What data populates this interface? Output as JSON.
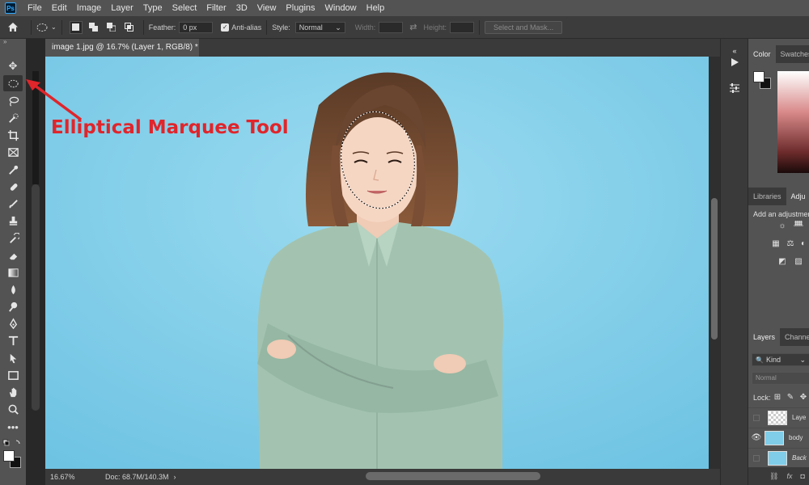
{
  "app": {
    "logo": "Ps"
  },
  "menu": [
    "File",
    "Edit",
    "Image",
    "Layer",
    "Type",
    "Select",
    "Filter",
    "3D",
    "View",
    "Plugins",
    "Window",
    "Help"
  ],
  "options": {
    "feather_label": "Feather:",
    "feather_value": "0 px",
    "antialias_label": "Anti-alias",
    "style_label": "Style:",
    "style_value": "Normal",
    "width_label": "Width:",
    "height_label": "Height:",
    "select_mask_label": "Select and Mask..."
  },
  "document": {
    "tab_title": "image 1.jpg @ 16.7% (Layer 1, RGB/8) *",
    "zoom": "16.67%",
    "doc_size": "Doc: 68.7M/140.3M"
  },
  "annotation": {
    "label": "Elliptical Marquee Tool",
    "color": "#e0252b"
  },
  "panels": {
    "color_tab": "Color",
    "swatches_tab": "Swatches",
    "libraries_tab": "Libraries",
    "adjustments_tab": "Adju",
    "adjustments_hint": "Add an adjustment",
    "layers_tab": "Layers",
    "channels_tab": "Channels",
    "kind_filter": "Kind",
    "blend_mode": "Normal",
    "lock_label": "Lock:",
    "layers": [
      {
        "name": "Laye",
        "visible": false,
        "selected": false
      },
      {
        "name": "body",
        "visible": true,
        "selected": false
      },
      {
        "name": "Back",
        "visible": false,
        "selected": false
      }
    ],
    "footer_icons": [
      "link-icon",
      "fx-icon",
      "mask-icon"
    ]
  },
  "colors": {
    "canvas_bg": "#7fcde8",
    "ui_dark": "#3a3a3a",
    "ui_mid": "#535353",
    "accent_ps": "#31a8ff"
  }
}
